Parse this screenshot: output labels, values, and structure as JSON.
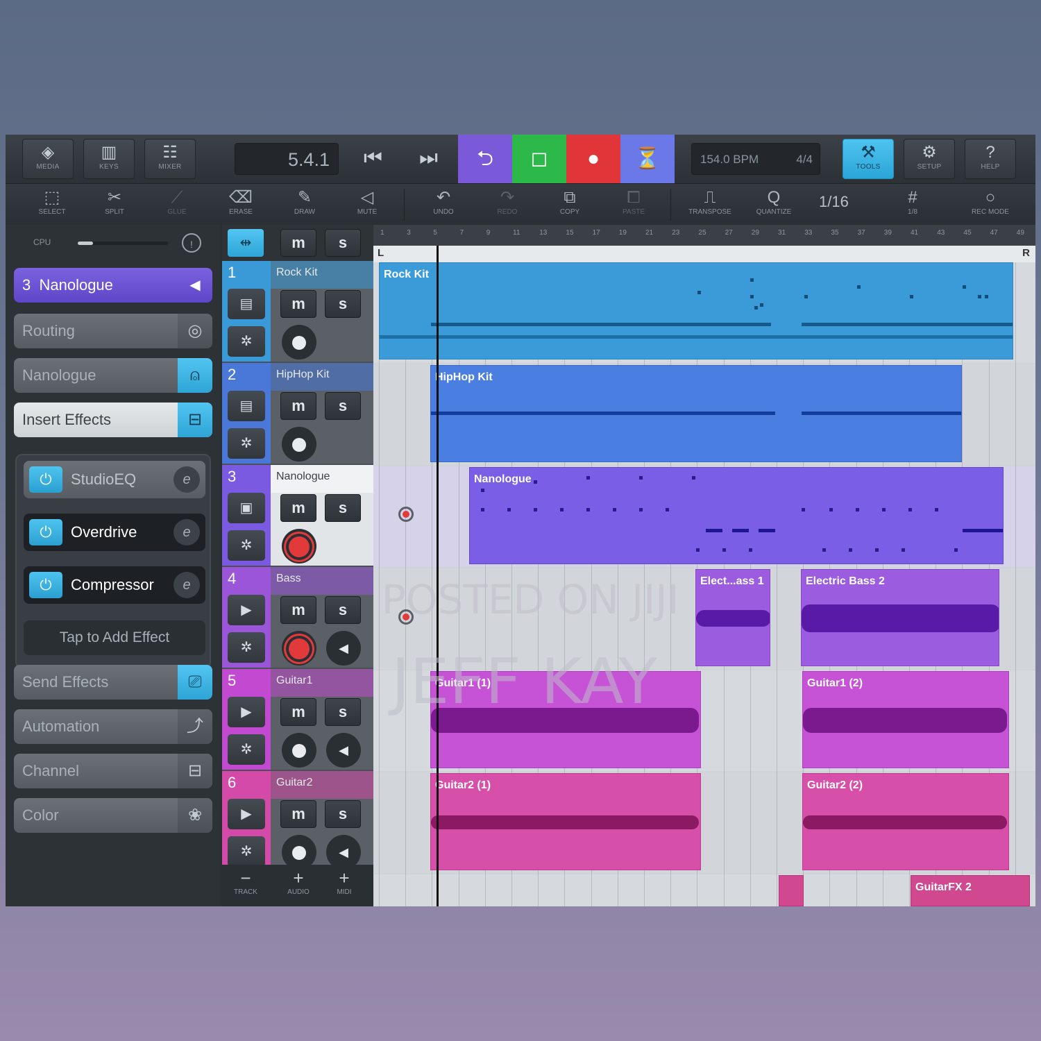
{
  "toolbar": {
    "media": "MEDIA",
    "keys": "KEYS",
    "mixer": "MIXER",
    "position": "5.4.1",
    "tempo": "154.0 BPM",
    "signature": "4/4",
    "tools": "TOOLS",
    "setup": "SETUP",
    "help": "HELP"
  },
  "edit_tools": {
    "select": "SELECT",
    "split": "SPLIT",
    "glue": "GLUE",
    "erase": "ERASE",
    "draw": "DRAW",
    "mute": "MUTE",
    "undo": "UNDO",
    "redo": "REDO",
    "copy": "COPY",
    "paste": "PASTE",
    "transpose": "TRANSPOSE",
    "quantize": "QUANTIZE",
    "quantize_value": "1/16",
    "grid": "1/8",
    "rec_mode": "REC MODE"
  },
  "inspector": {
    "cpu_label": "CPU",
    "cpu_load": 0.17,
    "track_number": "3",
    "track_name": "Nanologue",
    "items": {
      "routing": "Routing",
      "instrument": "Nanologue",
      "insert_effects": "Insert Effects",
      "send_effects": "Send Effects",
      "automation": "Automation",
      "channel": "Channel",
      "color": "Color"
    },
    "effects": [
      "StudioEQ",
      "Overdrive",
      "Compressor"
    ],
    "add_effect": "Tap to Add Effect"
  },
  "track_buttons": {
    "mute": "m",
    "solo": "s",
    "remove_track": "TRACK",
    "add_audio": "AUDIO",
    "add_midi": "MIDI"
  },
  "tracks": [
    {
      "number": "1",
      "name": "Rock Kit",
      "color": "#3a9ad8"
    },
    {
      "number": "2",
      "name": "HipHop Kit",
      "color": "#4a78d8"
    },
    {
      "number": "3",
      "name": "Nanologue",
      "color": "#7a5ae0"
    },
    {
      "number": "4",
      "name": "Bass",
      "color": "#9a55d8"
    },
    {
      "number": "5",
      "name": "Guitar1",
      "color": "#c24ad0"
    },
    {
      "number": "6",
      "name": "Guitar2",
      "color": "#d44aa8"
    }
  ],
  "ruler": {
    "numbers": [
      "1",
      "3",
      "5",
      "7",
      "9",
      "11",
      "13",
      "15",
      "17",
      "19",
      "21",
      "23",
      "25",
      "27",
      "29",
      "31",
      "33",
      "35",
      "37",
      "39",
      "41",
      "43",
      "45",
      "47",
      "49"
    ],
    "left_locator": "L",
    "right_locator": "R"
  },
  "clips": {
    "rock_kit": "Rock Kit",
    "hiphop_kit": "HipHop Kit",
    "nanologue": "Nanologue",
    "bass_1": "Elect...ass 1",
    "bass_2": "Electric Bass 2",
    "guitar1_1": "Guitar1 (1)",
    "guitar1_2": "Guitar1 (2)",
    "guitar2_1": "Guitar2 (1)",
    "guitar2_2": "Guitar2 (2)",
    "guitarfx_2": "GuitarFX 2"
  },
  "watermark": {
    "line1": "POSTED ON JIJI",
    "line2": "JEFF KAY"
  },
  "colors": {
    "transport_cycle": "#7a5ad8",
    "transport_stop": "#2db84a",
    "transport_record": "#e0363a",
    "transport_metronome": "#6a78e8",
    "accent": "#3db4e6"
  }
}
